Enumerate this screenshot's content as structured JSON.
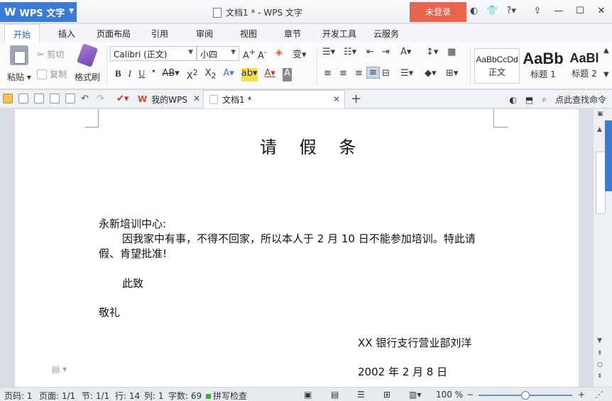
{
  "titlebar": {
    "app_name": "WPS 文字",
    "document_title": "文档1 * - WPS 文字",
    "login_label": "未登录",
    "icons": [
      "skin-icon",
      "shirt-icon",
      "help-icon",
      "share-icon",
      "minimize-icon",
      "maximize-icon",
      "close-icon"
    ]
  },
  "menu": {
    "tabs": [
      "开始",
      "插入",
      "页面布局",
      "引用",
      "审阅",
      "视图",
      "章节",
      "开发工具",
      "云服务"
    ]
  },
  "ribbon": {
    "paste_label": "粘贴",
    "cut_label": "剪切",
    "copy_label": "复制",
    "format_painter_label": "格式刷",
    "font_name": "Calibri (正文)",
    "font_size": "小四",
    "styles": [
      {
        "sample": "AaBbCcDd",
        "name": "正文"
      },
      {
        "sample": "AaBb",
        "name": "标题 1"
      },
      {
        "sample": "AaBl",
        "name": "标题 2"
      }
    ]
  },
  "quickbar": {
    "my_wps_tab": "我的WPS",
    "doc_tab": "文档1 *",
    "search_command": "点此查找命令"
  },
  "document": {
    "title": "请 假 条",
    "recipient": "永新培训中心:",
    "body_line1": "因我家中有事，不得不回家，所以本人于 2 月 10 日不能参加培训。特此请",
    "body_line2": "假、肯望批准!",
    "closing1": "此致",
    "closing2": "敬礼",
    "signature": "XX 银行支行营业部刘洋",
    "date": "2002 年 2 月 8 日"
  },
  "status": {
    "page_code": "页码: 1",
    "page": "页面: 1/1",
    "section": "节: 1/1",
    "row": "行: 14",
    "column": "列: 1",
    "word_count": "字数: 69",
    "spell_check": "拼写检查",
    "zoom": "100 %",
    "zoom_level": 0.5
  }
}
